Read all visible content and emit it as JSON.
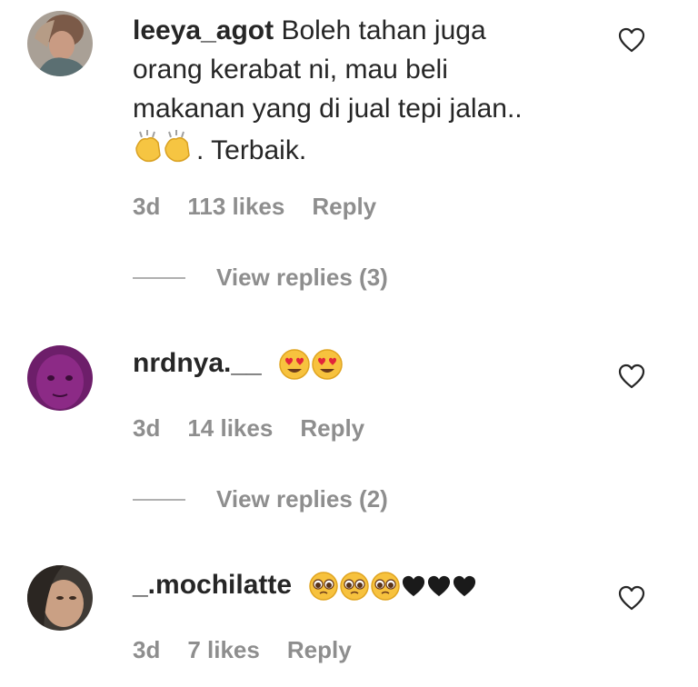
{
  "comments": [
    {
      "username": "leeya_agot",
      "text_lines": [
        "Boleh tahan juga",
        "orang kerabat ni, mau beli",
        "makanan yang di jual tepi jalan.."
      ],
      "text_after_emoji": ". Terbaik.",
      "emoji": [
        "clapping-hands",
        "clapping-hands"
      ],
      "time": "3d",
      "likes": "113 likes",
      "reply_label": "Reply",
      "view_replies": "View replies (3)"
    },
    {
      "username": "nrdnya.__",
      "emoji": [
        "smiling-heart-eyes",
        "smiling-heart-eyes"
      ],
      "time": "3d",
      "likes": "14 likes",
      "reply_label": "Reply",
      "view_replies": "View replies (2)"
    },
    {
      "username": "_.mochilatte",
      "emoji": [
        "pleading-face",
        "pleading-face",
        "pleading-face",
        "black-heart",
        "black-heart",
        "black-heart"
      ],
      "time": "3d",
      "likes": "7 likes",
      "reply_label": "Reply"
    }
  ],
  "icons": {
    "like": "heart-outline-icon"
  },
  "colors": {
    "text": "#262626",
    "meta": "#8e8e8e",
    "divider": "#b0b0b0",
    "background": "#ffffff"
  }
}
